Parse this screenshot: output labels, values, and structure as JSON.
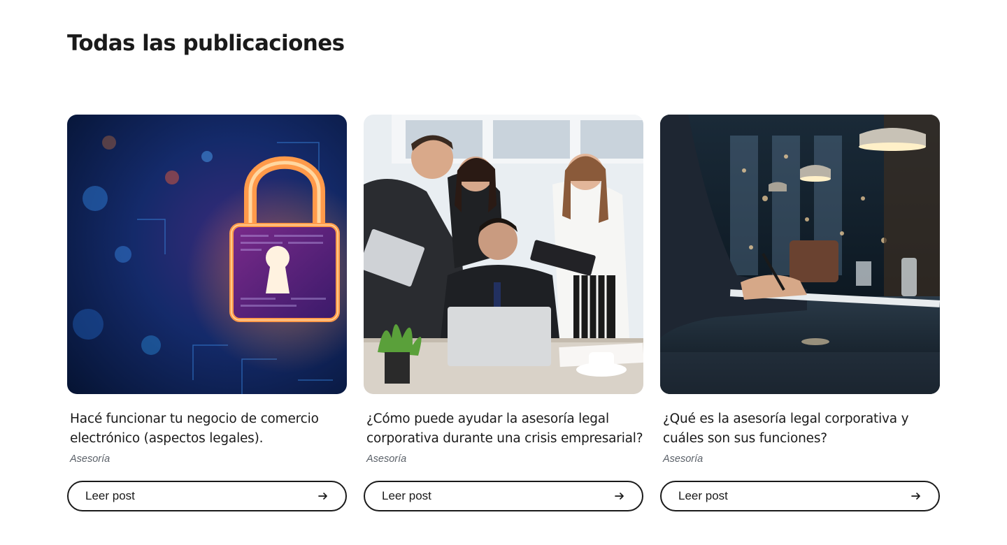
{
  "page": {
    "title": "Todas las publicaciones"
  },
  "posts": [
    {
      "title": "Hacé funcionar tu negocio de comercio electrónico (aspectos legales).",
      "category": "Asesoría",
      "button_label": "Leer post",
      "image": "cybersecurity-padlock-image"
    },
    {
      "title": "¿Cómo puede ayudar la asesoría legal corporativa durante una crisis empresarial?",
      "category": "Asesoría",
      "button_label": "Leer post",
      "image": "stressed-businessman-team-image"
    },
    {
      "title": "¿Qué es la asesoría legal corporativa y cuáles son sus funciones?",
      "category": "Asesoría",
      "button_label": "Leer post",
      "image": "signing-document-office-image"
    }
  ],
  "icons": {
    "button_icon": "arrow-right-icon"
  },
  "colors": {
    "text": "#1a1a1a",
    "category": "#5a6068",
    "button_border": "#1a1a1a",
    "background": "#ffffff"
  }
}
